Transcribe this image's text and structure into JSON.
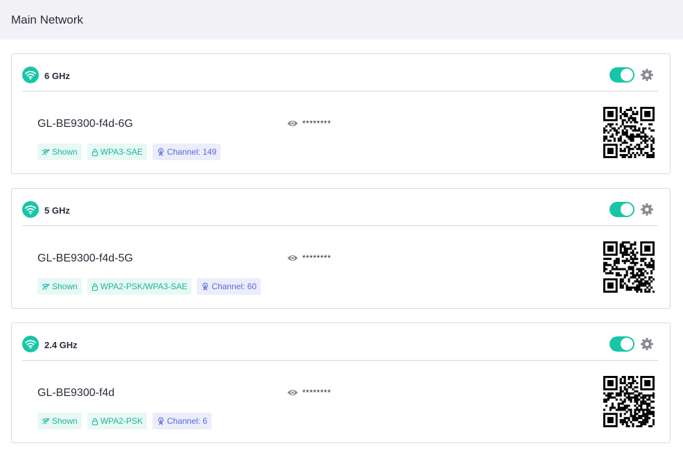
{
  "header": {
    "title": "Main Network"
  },
  "networks": [
    {
      "band": "6 GHz",
      "ssid": "GL-BE9300-f4d-6G",
      "password_masked": "********",
      "enabled": true,
      "tags": {
        "visibility": "Shown",
        "security": "WPA3-SAE",
        "channel": "Channel: 149"
      }
    },
    {
      "band": "5 GHz",
      "ssid": "GL-BE9300-f4d-5G",
      "password_masked": "********",
      "enabled": true,
      "tags": {
        "visibility": "Shown",
        "security": "WPA2-PSK/WPA3-SAE",
        "channel": "Channel: 60"
      }
    },
    {
      "band": "2.4 GHz",
      "ssid": "GL-BE9300-f4d",
      "password_masked": "********",
      "enabled": true,
      "tags": {
        "visibility": "Shown",
        "security": "WPA2-PSK",
        "channel": "Channel: 6"
      }
    }
  ],
  "colors": {
    "accent": "#16c6a7",
    "tag_teal": "#16b79c",
    "tag_purple": "#5c67d8"
  },
  "icons": [
    "wifi-icon",
    "gear-icon",
    "eye-icon",
    "broadcast-icon",
    "lock-icon",
    "antenna-icon",
    "qr-code-icon"
  ]
}
